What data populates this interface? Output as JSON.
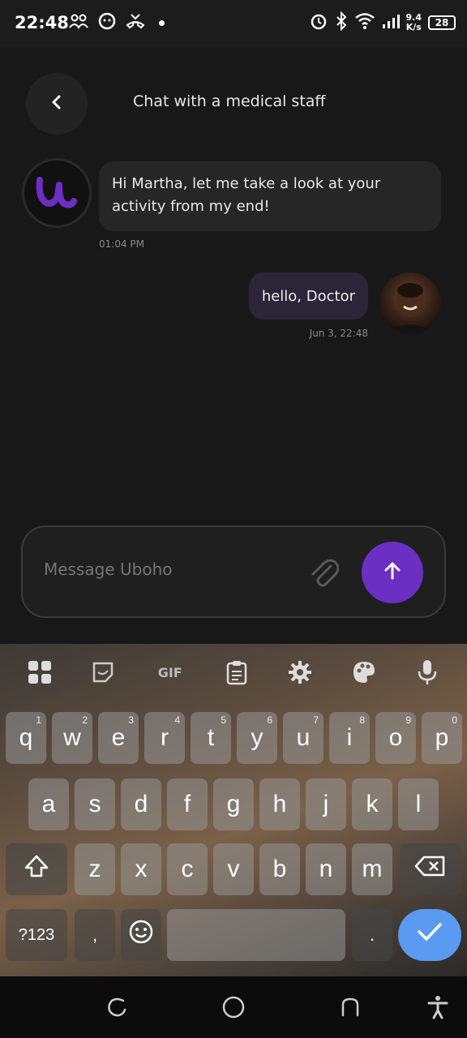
{
  "status_bar": {
    "time": "22:48",
    "speed_value": "9.4",
    "speed_unit": "K/s",
    "battery": "28"
  },
  "header": {
    "title": "Chat with a medical staff",
    "back_icon": "chevron-left-icon"
  },
  "messages": [
    {
      "direction": "incoming",
      "text": "Hi Martha, let me take a look at your activity from my end!",
      "time": "01:04 PM",
      "avatar": "uboho-logo"
    },
    {
      "direction": "outgoing",
      "text": "hello, Doctor",
      "time": "Jun 3, 22:48",
      "avatar": "user-photo"
    }
  ],
  "composer": {
    "placeholder": "Message Uboho",
    "attach_icon": "paperclip-icon",
    "send_icon": "arrow-up-icon",
    "accent_color": "#6b2fc4"
  },
  "keyboard": {
    "toolbar": [
      "apps-icon",
      "sticker-icon",
      "GIF",
      "clipboard-icon",
      "gear-icon",
      "palette-icon",
      "mic-icon"
    ],
    "gif_label": "GIF",
    "row1": [
      {
        "key": "q",
        "hint": "1"
      },
      {
        "key": "w",
        "hint": "2"
      },
      {
        "key": "e",
        "hint": "3"
      },
      {
        "key": "r",
        "hint": "4"
      },
      {
        "key": "t",
        "hint": "5"
      },
      {
        "key": "y",
        "hint": "6"
      },
      {
        "key": "u",
        "hint": "7"
      },
      {
        "key": "i",
        "hint": "8"
      },
      {
        "key": "o",
        "hint": "9"
      },
      {
        "key": "p",
        "hint": "0"
      }
    ],
    "row2": [
      "a",
      "s",
      "d",
      "f",
      "g",
      "h",
      "j",
      "k",
      "l"
    ],
    "row3": [
      "z",
      "x",
      "c",
      "v",
      "b",
      "n",
      "m"
    ],
    "symbols_label": "?123",
    "comma_label": ",",
    "period_label": ".",
    "enter_color": "#5a9af0"
  },
  "nav_bar": [
    "recents-icon",
    "home-icon",
    "back-icon",
    "accessibility-icon"
  ]
}
